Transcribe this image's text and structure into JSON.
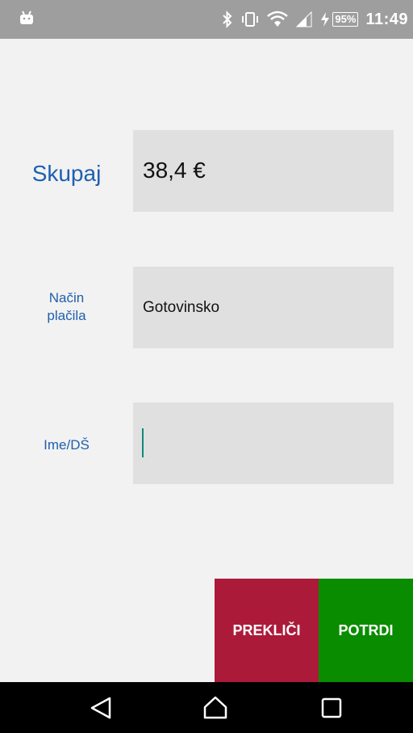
{
  "status_bar": {
    "battery_percent": "95%",
    "time": "11:49",
    "icons": [
      "android-icon",
      "bluetooth-icon",
      "vibrate-icon",
      "wifi-icon",
      "signal-icon",
      "charging-icon",
      "battery-icon"
    ]
  },
  "form": {
    "total_label": "Skupaj",
    "total_value": "38,4 €",
    "payment_label_line1": "Način",
    "payment_label_line2": "plačila",
    "payment_value": "Gotovinsko",
    "name_label": "Ime/DŠ",
    "name_value": ""
  },
  "actions": {
    "cancel_label": "PREKLIČI",
    "confirm_label": "POTRDI"
  },
  "colors": {
    "label_blue": "#1f5fb0",
    "cancel_red": "#ac1a3a",
    "confirm_green": "#0a8c00",
    "field_bg": "#e0e0e0",
    "status_bar": "#9e9e9e"
  },
  "nav_bar": {
    "icons": [
      "back-icon",
      "home-icon",
      "recent-apps-icon"
    ]
  }
}
